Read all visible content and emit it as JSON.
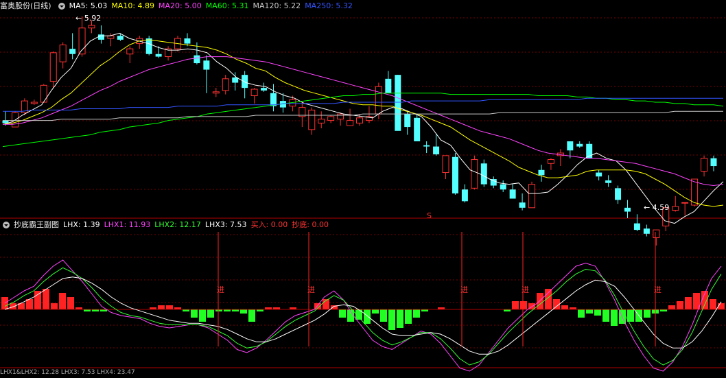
{
  "main_header": {
    "title": "富奥股份(日线)",
    "ma": [
      {
        "label": "MA5: 5.03",
        "color": "#ffffff"
      },
      {
        "label": "MA10: 4.89",
        "color": "#ffff00"
      },
      {
        "label": "MA20: 5.00",
        "color": "#ff44ff"
      },
      {
        "label": "MA60: 5.31",
        "color": "#00ff00"
      },
      {
        "label": "MA120: 5.22",
        "color": "#c8c8c8"
      },
      {
        "label": "MA250: 5.32",
        "color": "#3355ff"
      }
    ]
  },
  "sub_header": {
    "title": "抄底霸王副图",
    "items": [
      {
        "label": "LHX: 1.39",
        "color": "#ffffff"
      },
      {
        "label": "LHX1: 11.93",
        "color": "#ff44ff"
      },
      {
        "label": "LHX2: 12.17",
        "color": "#33ff33"
      },
      {
        "label": "LHX3: 7.53",
        "color": "#ffffff"
      },
      {
        "label": "买入: 0.00",
        "color": "#ff3333"
      },
      {
        "label": "抄底: 0.00",
        "color": "#ff3333"
      }
    ]
  },
  "bottom_header": {
    "text": "LHX1&LHX2: 12.28 LHX3: 7.53 LHX4: 23.47"
  },
  "annotations": {
    "high": "5.92",
    "low": "4.59",
    "marker": "S",
    "entry_label": "进"
  },
  "colors": {
    "up": "#ff3333",
    "down": "#54ffff",
    "grid": "#7a0000",
    "border": "#b00000"
  },
  "chart_data": {
    "type": "candlestick",
    "title": "富奥股份(日线)",
    "ohlc": [
      [
        5.15,
        5.22,
        5.11,
        5.13
      ],
      [
        5.1,
        5.22,
        5.1,
        5.21
      ],
      [
        5.21,
        5.32,
        5.19,
        5.3
      ],
      [
        5.28,
        5.31,
        5.27,
        5.29
      ],
      [
        5.29,
        5.43,
        5.29,
        5.42
      ],
      [
        5.45,
        5.68,
        5.4,
        5.67
      ],
      [
        5.6,
        5.75,
        5.55,
        5.73
      ],
      [
        5.7,
        5.82,
        5.62,
        5.66
      ],
      [
        5.66,
        5.95,
        5.64,
        5.86
      ],
      [
        5.86,
        5.92,
        5.82,
        5.88
      ],
      [
        5.81,
        5.88,
        5.74,
        5.77
      ],
      [
        5.78,
        5.82,
        5.72,
        5.8
      ],
      [
        5.8,
        5.82,
        5.76,
        5.77
      ],
      [
        5.66,
        5.72,
        5.59,
        5.7
      ],
      [
        5.74,
        5.8,
        5.7,
        5.78
      ],
      [
        5.78,
        5.8,
        5.65,
        5.66
      ],
      [
        5.66,
        5.72,
        5.63,
        5.64
      ],
      [
        5.64,
        5.72,
        5.61,
        5.7
      ],
      [
        5.7,
        5.8,
        5.68,
        5.78
      ],
      [
        5.78,
        5.82,
        5.72,
        5.74
      ],
      [
        5.65,
        5.75,
        5.58,
        5.59
      ],
      [
        5.61,
        5.65,
        5.36,
        5.54
      ],
      [
        5.36,
        5.4,
        5.33,
        5.37
      ],
      [
        5.38,
        5.5,
        5.35,
        5.47
      ],
      [
        5.48,
        5.52,
        5.38,
        5.44
      ],
      [
        5.5,
        5.53,
        5.32,
        5.4
      ],
      [
        5.34,
        5.4,
        5.28,
        5.39
      ],
      [
        5.4,
        5.44,
        5.37,
        5.38
      ],
      [
        5.36,
        5.43,
        5.22,
        5.26
      ],
      [
        5.3,
        5.36,
        5.21,
        5.25
      ],
      [
        5.26,
        5.34,
        5.22,
        5.31
      ],
      [
        5.18,
        5.29,
        5.1,
        5.25
      ],
      [
        5.08,
        5.25,
        5.04,
        5.23
      ],
      [
        5.13,
        5.22,
        5.09,
        5.16
      ],
      [
        5.15,
        5.19,
        5.13,
        5.18
      ],
      [
        5.16,
        5.21,
        5.11,
        5.2
      ],
      [
        5.11,
        5.24,
        5.11,
        5.15
      ],
      [
        5.13,
        5.2,
        5.11,
        5.17
      ],
      [
        5.15,
        5.26,
        5.13,
        5.18
      ],
      [
        5.2,
        5.44,
        5.16,
        5.41
      ],
      [
        5.47,
        5.53,
        5.41,
        5.36
      ],
      [
        5.5,
        5.5,
        5.08,
        5.07
      ],
      [
        5.2,
        5.22,
        5.04,
        5.1
      ],
      [
        5.17,
        5.2,
        5.02,
        4.99
      ],
      [
        4.96,
        4.99,
        4.9,
        4.95
      ],
      [
        4.95,
        5.05,
        4.88,
        4.89
      ],
      [
        4.75,
        4.85,
        4.7,
        4.88
      ],
      [
        4.87,
        4.9,
        4.58,
        4.59
      ],
      [
        4.62,
        4.66,
        4.52,
        4.53
      ],
      [
        4.63,
        4.88,
        4.62,
        4.85
      ],
      [
        4.82,
        4.85,
        4.64,
        4.66
      ],
      [
        4.7,
        4.72,
        4.63,
        4.65
      ],
      [
        4.66,
        4.69,
        4.6,
        4.62
      ],
      [
        4.62,
        4.66,
        4.55,
        4.55
      ],
      [
        4.52,
        4.59,
        4.46,
        4.48
      ],
      [
        4.48,
        4.68,
        4.48,
        4.66
      ],
      [
        4.77,
        4.81,
        4.68,
        4.73
      ],
      [
        4.82,
        4.86,
        4.77,
        4.85
      ],
      [
        4.88,
        4.93,
        4.8,
        4.9
      ],
      [
        4.99,
        4.99,
        4.86,
        4.92
      ],
      [
        4.97,
        4.99,
        4.94,
        4.95
      ],
      [
        4.97,
        4.99,
        4.87,
        4.86
      ],
      [
        4.75,
        4.77,
        4.69,
        4.72
      ],
      [
        4.69,
        4.73,
        4.64,
        4.67
      ],
      [
        4.63,
        4.65,
        4.51,
        4.54
      ],
      [
        4.48,
        4.54,
        4.4,
        4.45
      ],
      [
        4.36,
        4.43,
        4.3,
        4.31
      ],
      [
        4.32,
        4.35,
        4.26,
        4.28
      ],
      [
        4.25,
        4.26,
        4.19,
        4.31
      ],
      [
        4.34,
        4.37,
        4.3,
        4.48
      ],
      [
        4.46,
        4.57,
        4.45,
        4.49
      ],
      [
        4.52,
        4.52,
        4.42,
        4.52
      ],
      [
        4.5,
        4.63,
        4.49,
        4.7
      ],
      [
        4.76,
        4.88,
        4.72,
        4.86
      ],
      [
        4.86,
        4.88,
        4.76,
        4.8
      ]
    ],
    "series": [
      {
        "name": "MA5",
        "color": "#ffffff",
        "values": [
          5.12,
          5.14,
          5.19,
          5.23,
          5.27,
          5.38,
          5.48,
          5.55,
          5.68,
          5.76,
          5.8,
          5.8,
          5.82,
          5.78,
          5.76,
          5.74,
          5.71,
          5.69,
          5.69,
          5.7,
          5.69,
          5.67,
          5.6,
          5.55,
          5.48,
          5.44,
          5.42,
          5.41,
          5.37,
          5.34,
          5.32,
          5.28,
          5.26,
          5.24,
          5.22,
          5.2,
          5.19,
          5.18,
          5.17,
          5.22,
          5.25,
          5.24,
          5.21,
          5.18,
          5.1,
          5.0,
          4.96,
          4.86,
          4.77,
          4.74,
          4.7,
          4.67,
          4.66,
          4.67,
          4.59,
          4.59,
          4.6,
          4.66,
          4.73,
          4.81,
          4.87,
          4.9,
          4.86,
          4.84,
          4.77,
          4.67,
          4.57,
          4.47,
          4.38,
          4.36,
          4.41,
          4.45,
          4.53,
          4.61,
          4.68
        ]
      },
      {
        "name": "MA10",
        "color": "#ffff00",
        "values": [
          5.12,
          5.13,
          5.15,
          5.18,
          5.21,
          5.25,
          5.31,
          5.36,
          5.43,
          5.5,
          5.57,
          5.62,
          5.68,
          5.73,
          5.76,
          5.77,
          5.76,
          5.75,
          5.74,
          5.73,
          5.72,
          5.71,
          5.69,
          5.66,
          5.62,
          5.59,
          5.55,
          5.53,
          5.48,
          5.44,
          5.41,
          5.38,
          5.36,
          5.34,
          5.32,
          5.3,
          5.28,
          5.27,
          5.27,
          5.26,
          5.26,
          5.23,
          5.21,
          5.19,
          5.16,
          5.13,
          5.1,
          5.05,
          5.0,
          4.96,
          4.92,
          4.88,
          4.84,
          4.79,
          4.76,
          4.73,
          4.71,
          4.71,
          4.72,
          4.73,
          4.76,
          4.77,
          4.77,
          4.77,
          4.77,
          4.76,
          4.74,
          4.7,
          4.66,
          4.61,
          4.56,
          4.52,
          4.5,
          4.49,
          4.5
        ]
      },
      {
        "name": "MA20",
        "color": "#ff44ff",
        "values": [
          5.12,
          5.12,
          5.13,
          5.15,
          5.17,
          5.2,
          5.23,
          5.26,
          5.3,
          5.34,
          5.38,
          5.41,
          5.45,
          5.48,
          5.51,
          5.54,
          5.56,
          5.58,
          5.6,
          5.62,
          5.63,
          5.64,
          5.64,
          5.64,
          5.63,
          5.62,
          5.61,
          5.6,
          5.58,
          5.56,
          5.54,
          5.52,
          5.5,
          5.48,
          5.46,
          5.44,
          5.42,
          5.4,
          5.38,
          5.36,
          5.34,
          5.31,
          5.28,
          5.25,
          5.22,
          5.19,
          5.16,
          5.13,
          5.1,
          5.07,
          5.05,
          5.03,
          5.01,
          4.98,
          4.95,
          4.92,
          4.9,
          4.89,
          4.88,
          4.87,
          4.86,
          4.86,
          4.85,
          4.84,
          4.83,
          4.82,
          4.8,
          4.78,
          4.76,
          4.74,
          4.71,
          4.68,
          4.66,
          4.65,
          4.66
        ]
      },
      {
        "name": "MA60",
        "color": "#00ff00",
        "values": [
          4.95,
          4.96,
          4.97,
          4.98,
          4.99,
          5.0,
          5.01,
          5.02,
          5.03,
          5.04,
          5.06,
          5.07,
          5.08,
          5.1,
          5.11,
          5.12,
          5.13,
          5.15,
          5.16,
          5.17,
          5.18,
          5.2,
          5.21,
          5.22,
          5.23,
          5.24,
          5.25,
          5.26,
          5.27,
          5.28,
          5.29,
          5.3,
          5.31,
          5.32,
          5.33,
          5.34,
          5.34,
          5.35,
          5.35,
          5.36,
          5.36,
          5.36,
          5.36,
          5.36,
          5.36,
          5.36,
          5.35,
          5.35,
          5.35,
          5.35,
          5.35,
          5.35,
          5.35,
          5.35,
          5.35,
          5.34,
          5.34,
          5.34,
          5.34,
          5.33,
          5.33,
          5.32,
          5.32,
          5.31,
          5.31,
          5.3,
          5.3,
          5.29,
          5.29,
          5.28,
          5.28,
          5.27,
          5.27,
          5.27,
          5.26
        ]
      },
      {
        "name": "MA120",
        "color": "#c8c8c8",
        "values": [
          5.15,
          5.15,
          5.15,
          5.15,
          5.15,
          5.15,
          5.16,
          5.16,
          5.16,
          5.16,
          5.16,
          5.16,
          5.17,
          5.17,
          5.17,
          5.17,
          5.17,
          5.17,
          5.17,
          5.18,
          5.18,
          5.18,
          5.18,
          5.18,
          5.18,
          5.18,
          5.19,
          5.19,
          5.19,
          5.19,
          5.19,
          5.19,
          5.19,
          5.19,
          5.19,
          5.19,
          5.19,
          5.2,
          5.2,
          5.2,
          5.2,
          5.2,
          5.2,
          5.2,
          5.2,
          5.2,
          5.2,
          5.2,
          5.2,
          5.2,
          5.2,
          5.21,
          5.21,
          5.21,
          5.21,
          5.21,
          5.21,
          5.21,
          5.21,
          5.21,
          5.21,
          5.21,
          5.21,
          5.21,
          5.21,
          5.21,
          5.21,
          5.21,
          5.21,
          5.22,
          5.22,
          5.22,
          5.22,
          5.22,
          5.22
        ]
      },
      {
        "name": "MA250",
        "color": "#3355ff",
        "values": [
          5.22,
          5.22,
          5.22,
          5.23,
          5.23,
          5.23,
          5.23,
          5.23,
          5.24,
          5.24,
          5.24,
          5.24,
          5.24,
          5.25,
          5.25,
          5.25,
          5.25,
          5.25,
          5.26,
          5.26,
          5.26,
          5.26,
          5.26,
          5.27,
          5.27,
          5.27,
          5.27,
          5.27,
          5.27,
          5.28,
          5.28,
          5.28,
          5.28,
          5.28,
          5.28,
          5.29,
          5.29,
          5.29,
          5.29,
          5.29,
          5.29,
          5.29,
          5.3,
          5.3,
          5.3,
          5.3,
          5.3,
          5.3,
          5.3,
          5.3,
          5.31,
          5.31,
          5.31,
          5.31,
          5.31,
          5.31,
          5.31,
          5.31,
          5.31,
          5.31,
          5.32,
          5.32,
          5.32,
          5.32,
          5.32,
          5.32,
          5.32,
          5.32,
          5.32,
          5.32,
          5.32,
          5.32,
          5.32,
          5.32,
          5.32
        ]
      }
    ],
    "sub_chart": {
      "bars": [
        6,
        3,
        3,
        5,
        9,
        10,
        3,
        8,
        6,
        1,
        -1,
        -1,
        -1,
        0,
        0,
        0,
        0,
        0,
        1,
        2,
        2,
        1,
        -1,
        -4,
        -6,
        -4,
        -1,
        -1,
        -1,
        -2,
        -6,
        -1,
        1,
        1,
        0,
        1,
        0,
        0,
        3,
        5,
        2,
        -4,
        -6,
        -5,
        -7,
        -2,
        -6,
        -10,
        -9,
        -7,
        -4,
        -1,
        0,
        1,
        0,
        0,
        0,
        0,
        0,
        0,
        0,
        -1,
        4,
        4,
        3,
        8,
        10,
        5,
        2,
        1,
        -4,
        -2,
        -3,
        -6,
        -8,
        -7,
        -6,
        -6,
        -4,
        -2,
        -1,
        2,
        4,
        6,
        8,
        9,
        5,
        3
      ],
      "series": [
        {
          "name": "LHX1",
          "color": "#ff44ff",
          "values": [
            4,
            8,
            12,
            15,
            22,
            28,
            32,
            25,
            18,
            10,
            2,
            -2,
            -4,
            -5,
            -6,
            -9,
            -11,
            -12,
            -11,
            -10,
            -10,
            -12,
            -16,
            -20,
            -26,
            -28,
            -25,
            -20,
            -14,
            -8,
            -4,
            -2,
            0,
            8,
            12,
            6,
            -4,
            -12,
            -20,
            -24,
            -26,
            -22,
            -18,
            -14,
            -16,
            -22,
            -30,
            -38,
            -40,
            -36,
            -28,
            -20,
            -12,
            -6,
            0,
            4,
            10,
            16,
            22,
            28,
            30,
            28,
            18,
            6,
            -8,
            -20,
            -30,
            -38,
            -40,
            -34,
            -24,
            -10,
            6,
            20,
            28
          ]
        },
        {
          "name": "LHX2",
          "color": "#33ff33",
          "values": [
            2,
            5,
            9,
            12,
            18,
            23,
            27,
            24,
            20,
            14,
            7,
            2,
            -2,
            -4,
            -5,
            -7,
            -9,
            -10,
            -10,
            -10,
            -10,
            -11,
            -14,
            -17,
            -22,
            -25,
            -24,
            -21,
            -16,
            -11,
            -7,
            -4,
            -1,
            5,
            9,
            6,
            -1,
            -8,
            -15,
            -20,
            -23,
            -21,
            -18,
            -15,
            -15,
            -19,
            -25,
            -32,
            -36,
            -34,
            -29,
            -22,
            -15,
            -9,
            -3,
            2,
            7,
            12,
            18,
            23,
            26,
            25,
            19,
            9,
            -3,
            -14,
            -24,
            -32,
            -36,
            -33,
            -26,
            -15,
            -1,
            13,
            23
          ]
        },
        {
          "name": "LHX3",
          "color": "#ffffff",
          "values": [
            0,
            2,
            5,
            8,
            12,
            16,
            20,
            21,
            20,
            17,
            13,
            8,
            4,
            1,
            -1,
            -3,
            -5,
            -7,
            -8,
            -9,
            -9,
            -10,
            -11,
            -13,
            -16,
            -19,
            -21,
            -21,
            -19,
            -16,
            -13,
            -10,
            -7,
            -3,
            2,
            3,
            2,
            -2,
            -7,
            -12,
            -16,
            -17,
            -17,
            -16,
            -15,
            -16,
            -19,
            -23,
            -27,
            -29,
            -29,
            -27,
            -23,
            -18,
            -13,
            -8,
            -3,
            2,
            7,
            12,
            16,
            19,
            18,
            15,
            8,
            0,
            -8,
            -16,
            -22,
            -25,
            -25,
            -21,
            -14,
            -5,
            5
          ]
        }
      ],
      "entry_signals": [
        14,
        21,
        32,
        37,
        46
      ]
    }
  }
}
